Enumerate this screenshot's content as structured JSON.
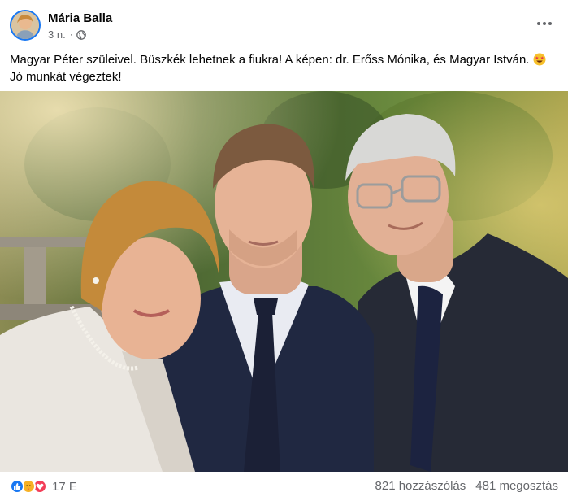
{
  "post": {
    "author": "Mária Balla",
    "time": "3 n.",
    "separator": "·",
    "privacy_icon": "globe-icon",
    "more_icon": "more-horizontal-icon",
    "text_main": "Magyar Péter szüleivel. Büszkék lehetnek a fiukra! A képen: dr. Erőss Mónika, és Magyar István.",
    "text_emoji": "star-struck-emoji",
    "text_tail": "Jó munkát végeztek!"
  },
  "footer": {
    "reaction_icons": [
      "like-icon",
      "care-icon",
      "love-icon"
    ],
    "reaction_count": "17 E",
    "comments": "821 hozzászólás",
    "shares": "481 megosztás"
  },
  "colors": {
    "accent": "#1877f2",
    "secondary_text": "#65676b",
    "like": "#1877f2",
    "care": "#f7b125",
    "love": "#f33e58"
  }
}
